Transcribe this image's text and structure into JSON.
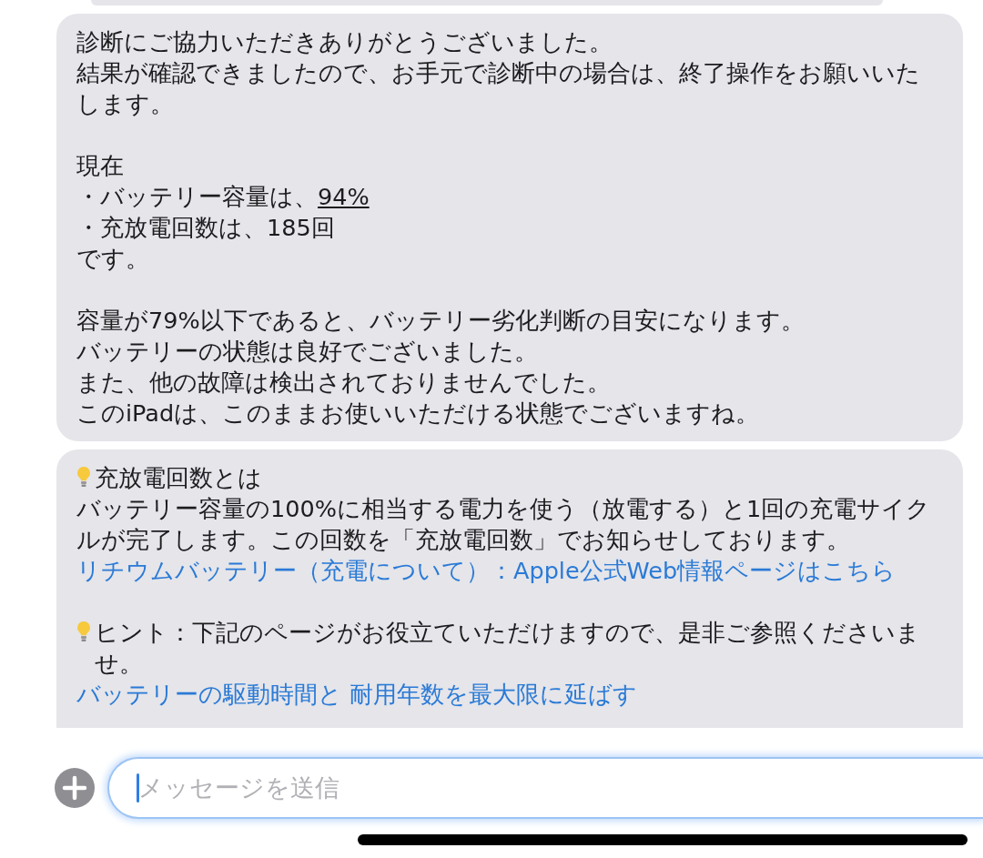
{
  "messages": [
    {
      "kind": "cropped"
    },
    {
      "kind": "text",
      "paragraphs": [
        {
          "lines": [
            {
              "kind": "plain",
              "text": "診断にご協力いただきありがとうございました。"
            },
            {
              "kind": "plain",
              "text": "結果が確認できましたので、お手元で診断中の場合は、終了操作をお願いいたします。"
            }
          ]
        },
        {
          "lines": [
            {
              "kind": "plain",
              "text": "現在"
            },
            {
              "kind": "plain",
              "text": "・バッテリー容量は、",
              "underlined": "94%"
            },
            {
              "kind": "plain",
              "text": "・充放電回数は、185回"
            },
            {
              "kind": "plain",
              "text": "です。"
            }
          ]
        },
        {
          "lines": [
            {
              "kind": "plain",
              "text": "容量が79%以下であると、バッテリー劣化判断の目安になります。"
            },
            {
              "kind": "plain",
              "text": "バッテリーの状態は良好でございました。"
            },
            {
              "kind": "plain",
              "text": "また、他の故障は検出されておりませんでした。"
            },
            {
              "kind": "plain",
              "text": "このiPadは、このままお使いいただける状態でございますね。"
            }
          ]
        }
      ]
    },
    {
      "kind": "text",
      "cut": true,
      "paragraphs": [
        {
          "lines": [
            {
              "kind": "tip",
              "text": "充放電回数とは"
            },
            {
              "kind": "plain",
              "text": "バッテリー容量の100%に相当する電力を使う（放電する）と1回の充電サイクルが完了します。この回数を「充放電回数」でお知らせしております。"
            },
            {
              "kind": "link",
              "text": "リチウムバッテリー（充電について）：Apple公式Web情報ページはこちら"
            }
          ]
        },
        {
          "lines": [
            {
              "kind": "tip",
              "text": "ヒント：下記のページがお役立ていただけますので、是非ご参照くださいませ。"
            },
            {
              "kind": "link",
              "text": "バッテリーの駆動時間と 耐用年数を最大限に延ばす"
            }
          ]
        }
      ]
    }
  ],
  "composer": {
    "placeholder": "メッセージを送信"
  }
}
